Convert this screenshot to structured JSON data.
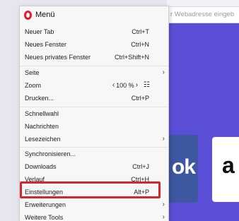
{
  "background": {
    "address_placeholder": "r Webadresse eingeb",
    "speed_dial_1_text": "ok",
    "speed_dial_2_text": "a"
  },
  "menu": {
    "title": "Menü",
    "items": [
      {
        "label": "Neuer Tab",
        "shortcut": "Ctrl+T"
      },
      {
        "label": "Neues Fenster",
        "shortcut": "Ctrl+N"
      },
      {
        "label": "Neues privates Fenster",
        "shortcut": "Ctrl+Shift+N"
      },
      {
        "label": "Seite",
        "submenu": true
      },
      {
        "label": "Zoom",
        "zoom_value": "100 %"
      },
      {
        "label": "Drucken...",
        "shortcut": "Ctrl+P"
      },
      {
        "label": "Schnellwahl"
      },
      {
        "label": "Nachrichten"
      },
      {
        "label": "Lesezeichen",
        "submenu": true
      },
      {
        "label": "Synchronisieren..."
      },
      {
        "label": "Downloads",
        "shortcut": "Ctrl+J"
      },
      {
        "label": "Verlauf",
        "shortcut": "Ctrl+H"
      },
      {
        "label": "Einstellungen",
        "shortcut": "Alt+P",
        "highlighted": true
      },
      {
        "label": "Erweiterungen",
        "submenu": true
      },
      {
        "label": "Weitere Tools",
        "submenu": true
      }
    ]
  },
  "colors": {
    "highlight_border": "#d4262f",
    "opera_red": "#e01f2c",
    "page_purple": "#5b4fd8"
  },
  "icons": {
    "logo": "opera-logo-icon",
    "submenu": "chevron-right-icon",
    "zoom_decrease": "chevron-left-icon",
    "zoom_increase": "chevron-right-icon",
    "fullscreen": "fullscreen-icon"
  }
}
